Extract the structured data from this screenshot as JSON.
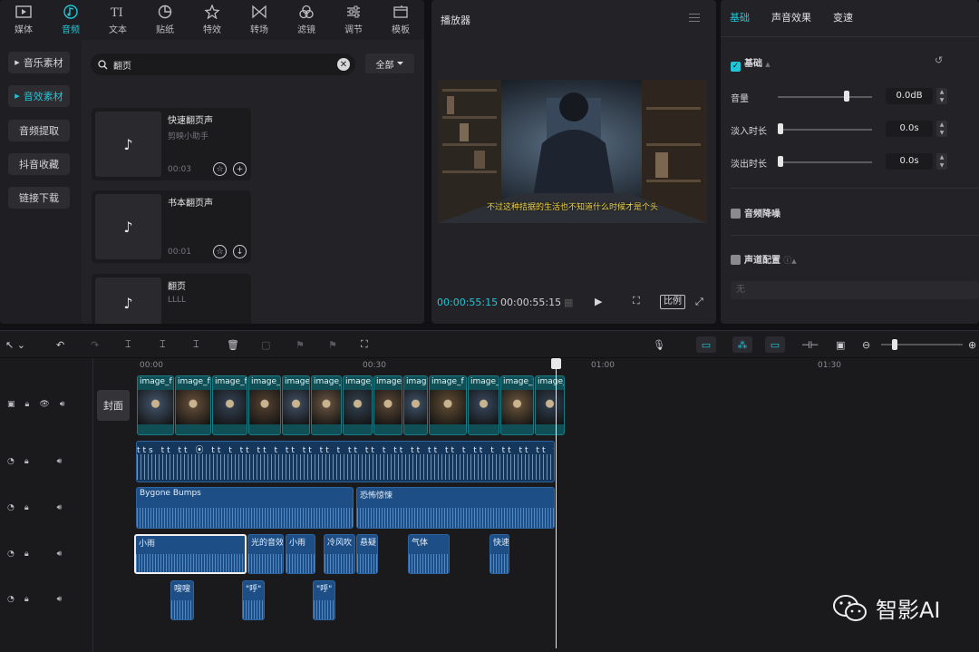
{
  "top_tabs": [
    {
      "label": "媒体",
      "icon": "media-icon"
    },
    {
      "label": "音频",
      "icon": "audio-icon"
    },
    {
      "label": "文本",
      "icon": "text-icon"
    },
    {
      "label": "贴纸",
      "icon": "sticker-icon"
    },
    {
      "label": "特效",
      "icon": "effects-icon"
    },
    {
      "label": "转场",
      "icon": "transition-icon"
    },
    {
      "label": "滤镜",
      "icon": "filter-icon"
    },
    {
      "label": "调节",
      "icon": "adjust-icon"
    },
    {
      "label": "模板",
      "icon": "template-icon"
    }
  ],
  "active_tab": "音频",
  "categories": [
    "音乐素材",
    "音效素材",
    "音频提取",
    "抖音收藏",
    "链接下载"
  ],
  "search": {
    "value": "翻页"
  },
  "filter_label": "全部",
  "cards": [
    {
      "name": "快速翻页声",
      "sub": "剪映小助手",
      "duration": "00:03"
    },
    {
      "name": "书本翻页声",
      "sub": "",
      "duration": "00:01"
    },
    {
      "name": "翻页",
      "sub": "LLLL",
      "duration": ""
    }
  ],
  "player": {
    "title": "播放器",
    "subtitle": "不过这种拮据的生活也不知道什么时候才是个头",
    "current_time": "00:00:55:15",
    "total_time": "00:00:55:15",
    "ratio_label": "比例"
  },
  "inspector": {
    "tabs": [
      "基础",
      "声音效果",
      "变速"
    ],
    "section_basic": "基础",
    "volume_label": "音量",
    "volume_value": "0.0dB",
    "fade_in_label": "淡入时长",
    "fade_in_value": "0.0s",
    "fade_out_label": "淡出时长",
    "fade_out_value": "0.0s",
    "denoise_label": "音频降噪",
    "channel_label": "声道配置",
    "channel_select": "无"
  },
  "timeline": {
    "ruler": [
      "00:00",
      "00:30",
      "01:00",
      "01:30"
    ],
    "cover_label": "封面",
    "video_clip_label": "image_f",
    "text_clip_label": "tts",
    "music_clips": [
      {
        "label": "Bygone Bumps"
      },
      {
        "label": "恐怖惊悚"
      }
    ],
    "sfx_clips": [
      {
        "label": "小雨"
      },
      {
        "label": "光的音效"
      },
      {
        "label": "小雨"
      },
      {
        "label": "冷风吹"
      },
      {
        "label": "悬疑"
      },
      {
        "label": "气体"
      },
      {
        "label": "快速"
      }
    ],
    "voice_clips": [
      {
        "label": "嗖嗖"
      },
      {
        "label": "\"呼\""
      },
      {
        "label": "\"呼\""
      }
    ]
  },
  "watermark": "智影AI",
  "colors": {
    "accent": "#22c5d6",
    "audio_clip": "#1d4f86",
    "video_clip": "#0f4f55"
  }
}
